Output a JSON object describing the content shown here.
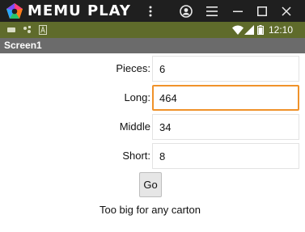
{
  "window": {
    "brand": "MEMU PLAY",
    "buttons": [
      "more-vert",
      "account",
      "menu",
      "minimize",
      "maximize",
      "close"
    ]
  },
  "status_bar": {
    "time": "12:10",
    "icons": [
      "sim-card-icon",
      "usb-icon",
      "notification-a-icon",
      "wifi-icon",
      "signal-icon",
      "battery-icon"
    ]
  },
  "app_bar": {
    "title": "Screen1"
  },
  "form": {
    "pieces_label": "Pieces:",
    "pieces_value": "6",
    "long_label": "Long:",
    "long_value": "464",
    "middle_label": "Middle",
    "middle_value": "34",
    "short_label": "Short:",
    "short_value": "8",
    "go_label": "Go",
    "result": "Too big for any carton"
  },
  "colors": {
    "titlebar": "#1f1f1f",
    "status_bar": "#5f6b2b",
    "app_bar": "#6b6b6b",
    "focus_border": "#f0922a"
  }
}
